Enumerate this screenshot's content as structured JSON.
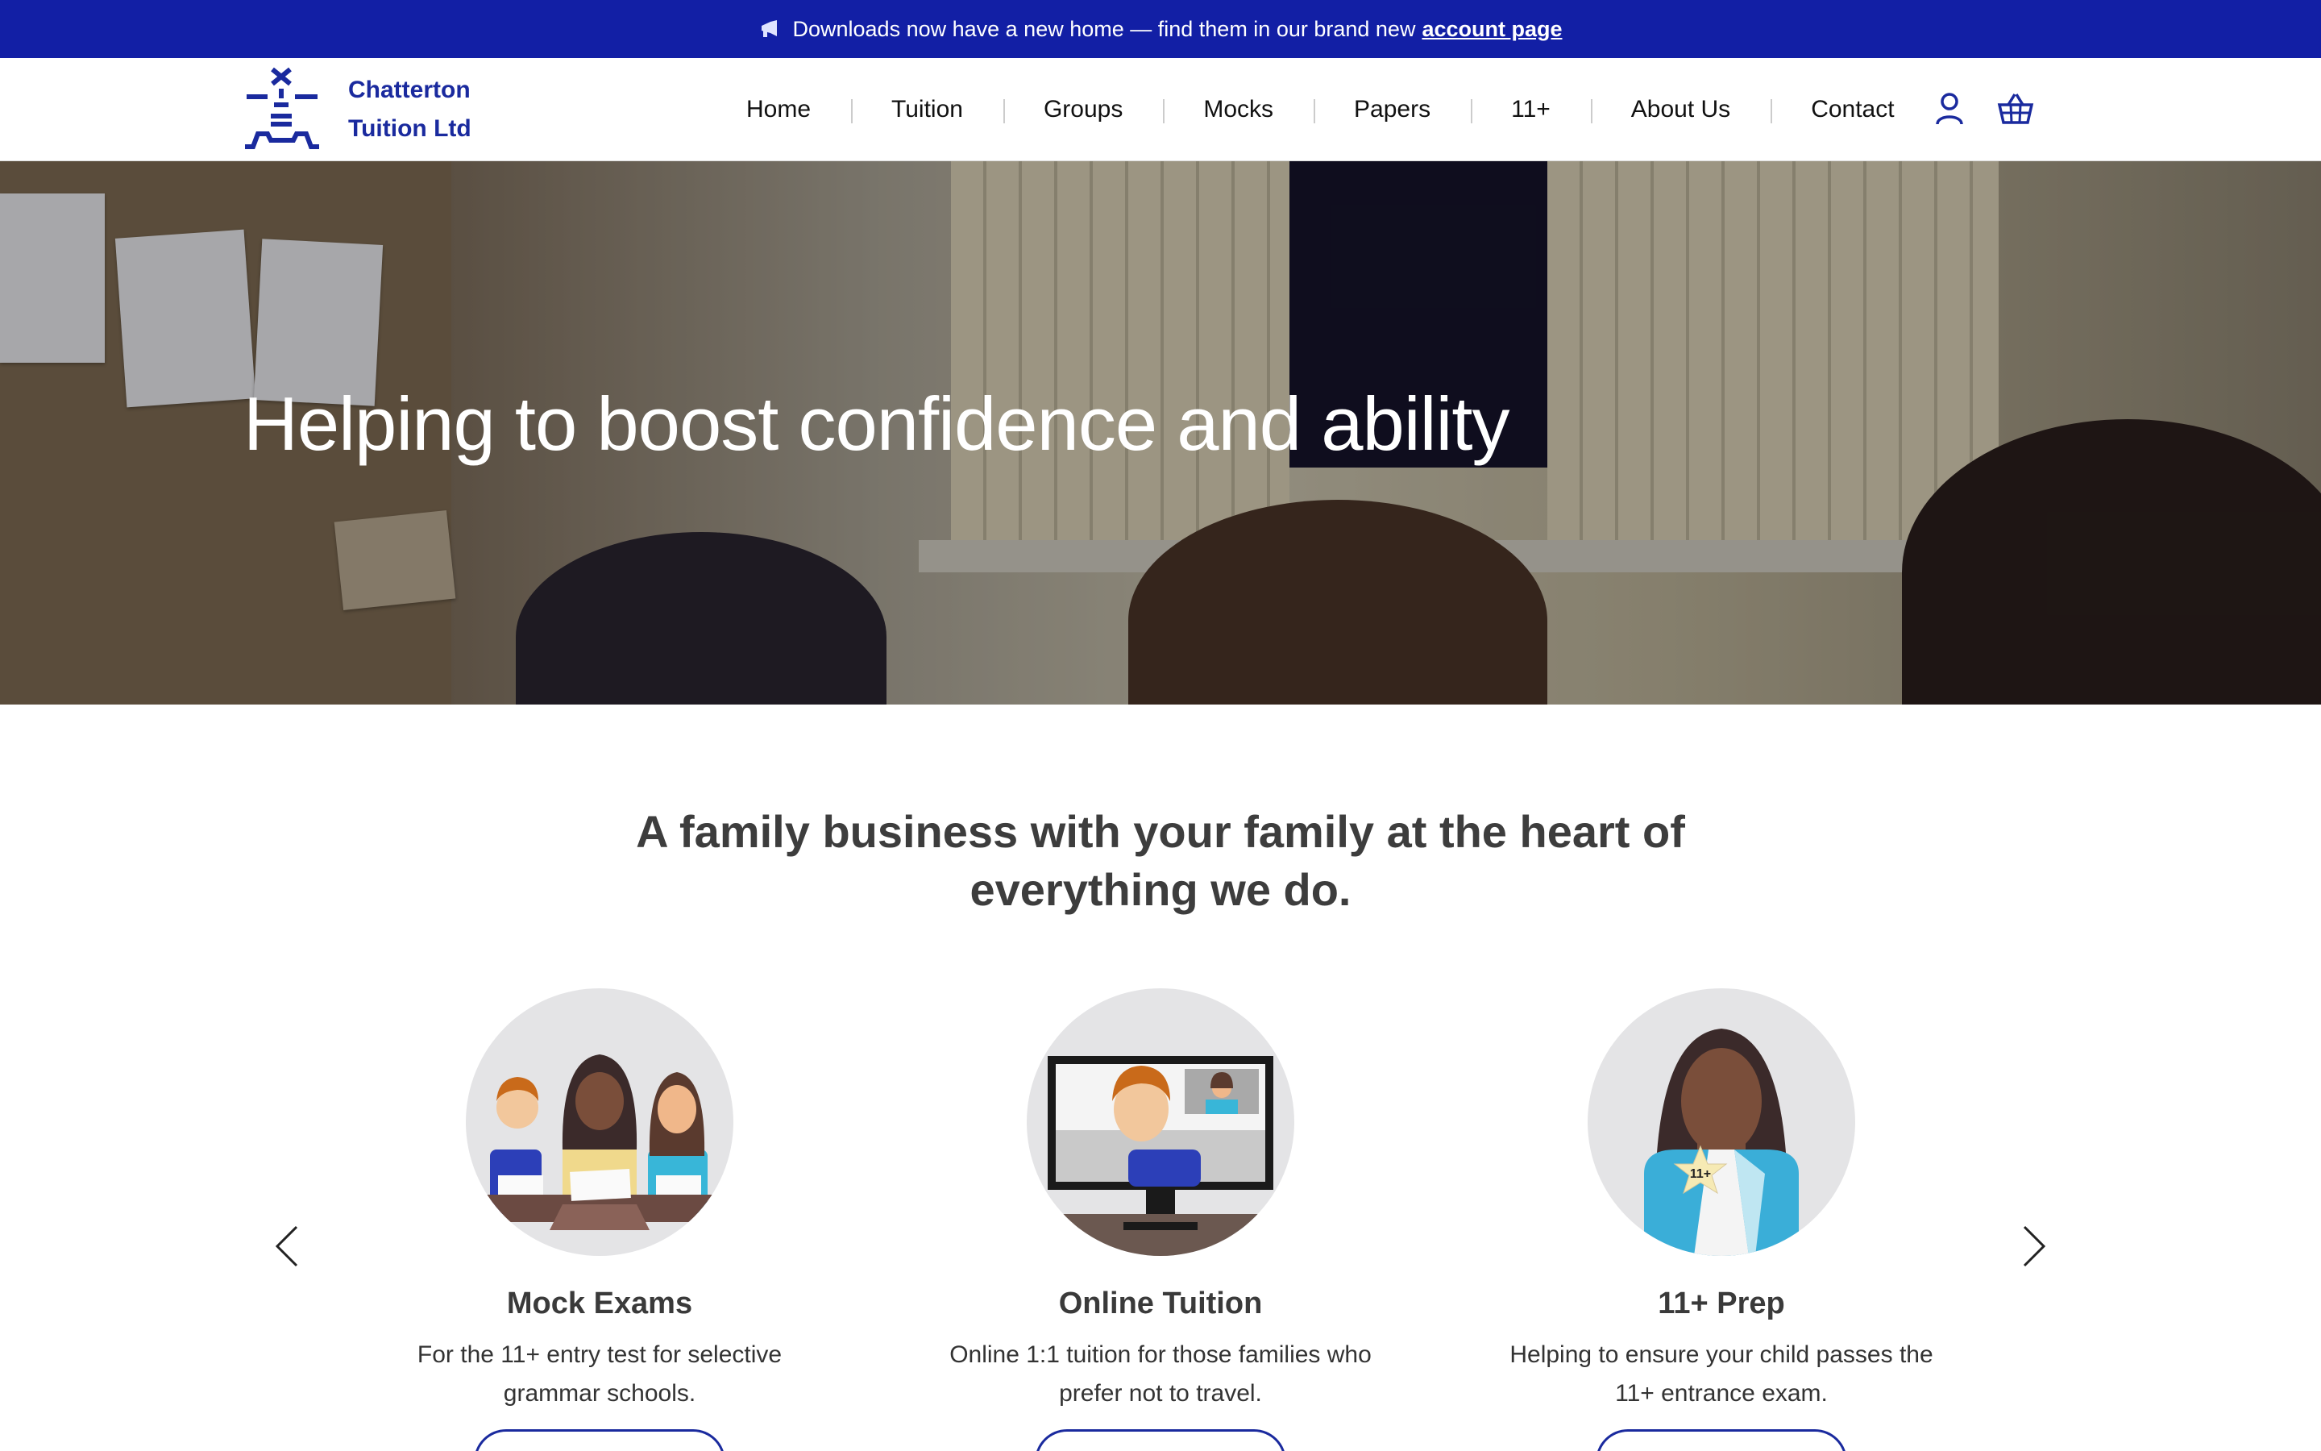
{
  "announcement": {
    "icon": "megaphone-icon",
    "text": "Downloads now have a new home — find them in our brand new",
    "link_text": "account page"
  },
  "brand": {
    "name_line1": "Chatterton",
    "name_line2": "Tuition Ltd",
    "color": "#1a2a9e"
  },
  "nav": {
    "items": [
      "Home",
      "Tuition",
      "Groups",
      "Mocks",
      "Papers",
      "11+",
      "About Us",
      "Contact"
    ]
  },
  "header_icons": [
    "account-icon",
    "basket-icon"
  ],
  "hero": {
    "title": "Helping to boost confidence and ability"
  },
  "tagline": "A family business with your family at the heart of everything we do.",
  "cards": [
    {
      "title": "Mock Exams",
      "text": "For the 11+ entry test for selective grammar schools.",
      "icon": "exam-students-icon"
    },
    {
      "title": "Online Tuition",
      "text": "Online 1:1 tuition for those families who prefer not to travel.",
      "icon": "video-call-icon"
    },
    {
      "title": "11+ Prep",
      "text": "Helping to ensure your child passes the 11+ entrance exam.",
      "icon": "student-star-icon",
      "badge": "11+"
    }
  ],
  "colors": {
    "announcement_bg": "#121fa5",
    "accent": "#1a2a9e"
  }
}
